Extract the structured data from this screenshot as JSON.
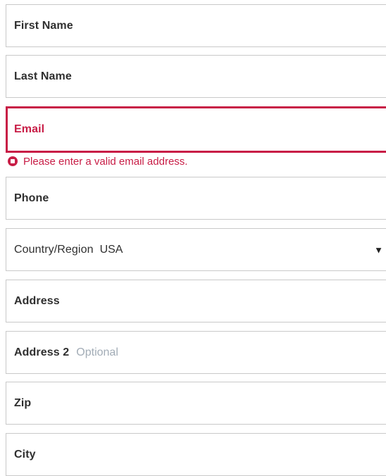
{
  "form": {
    "first_name": {
      "label": "First Name"
    },
    "last_name": {
      "label": "Last Name"
    },
    "email": {
      "label": "Email",
      "error": "Please enter a valid email address."
    },
    "phone": {
      "label": "Phone"
    },
    "country": {
      "label": "Country/Region",
      "selected": "USA",
      "caret": "▼"
    },
    "address": {
      "label": "Address"
    },
    "address2": {
      "label": "Address 2",
      "optional_hint": "Optional"
    },
    "zip": {
      "label": "Zip"
    },
    "city": {
      "label": "City"
    }
  },
  "colors": {
    "error": "#c81d46",
    "border": "#c9c9c9",
    "text": "#2f2f2f",
    "hint": "#a2acb6"
  },
  "icons": {
    "error": "error-icon",
    "dropdown": "chevron-down-icon"
  }
}
